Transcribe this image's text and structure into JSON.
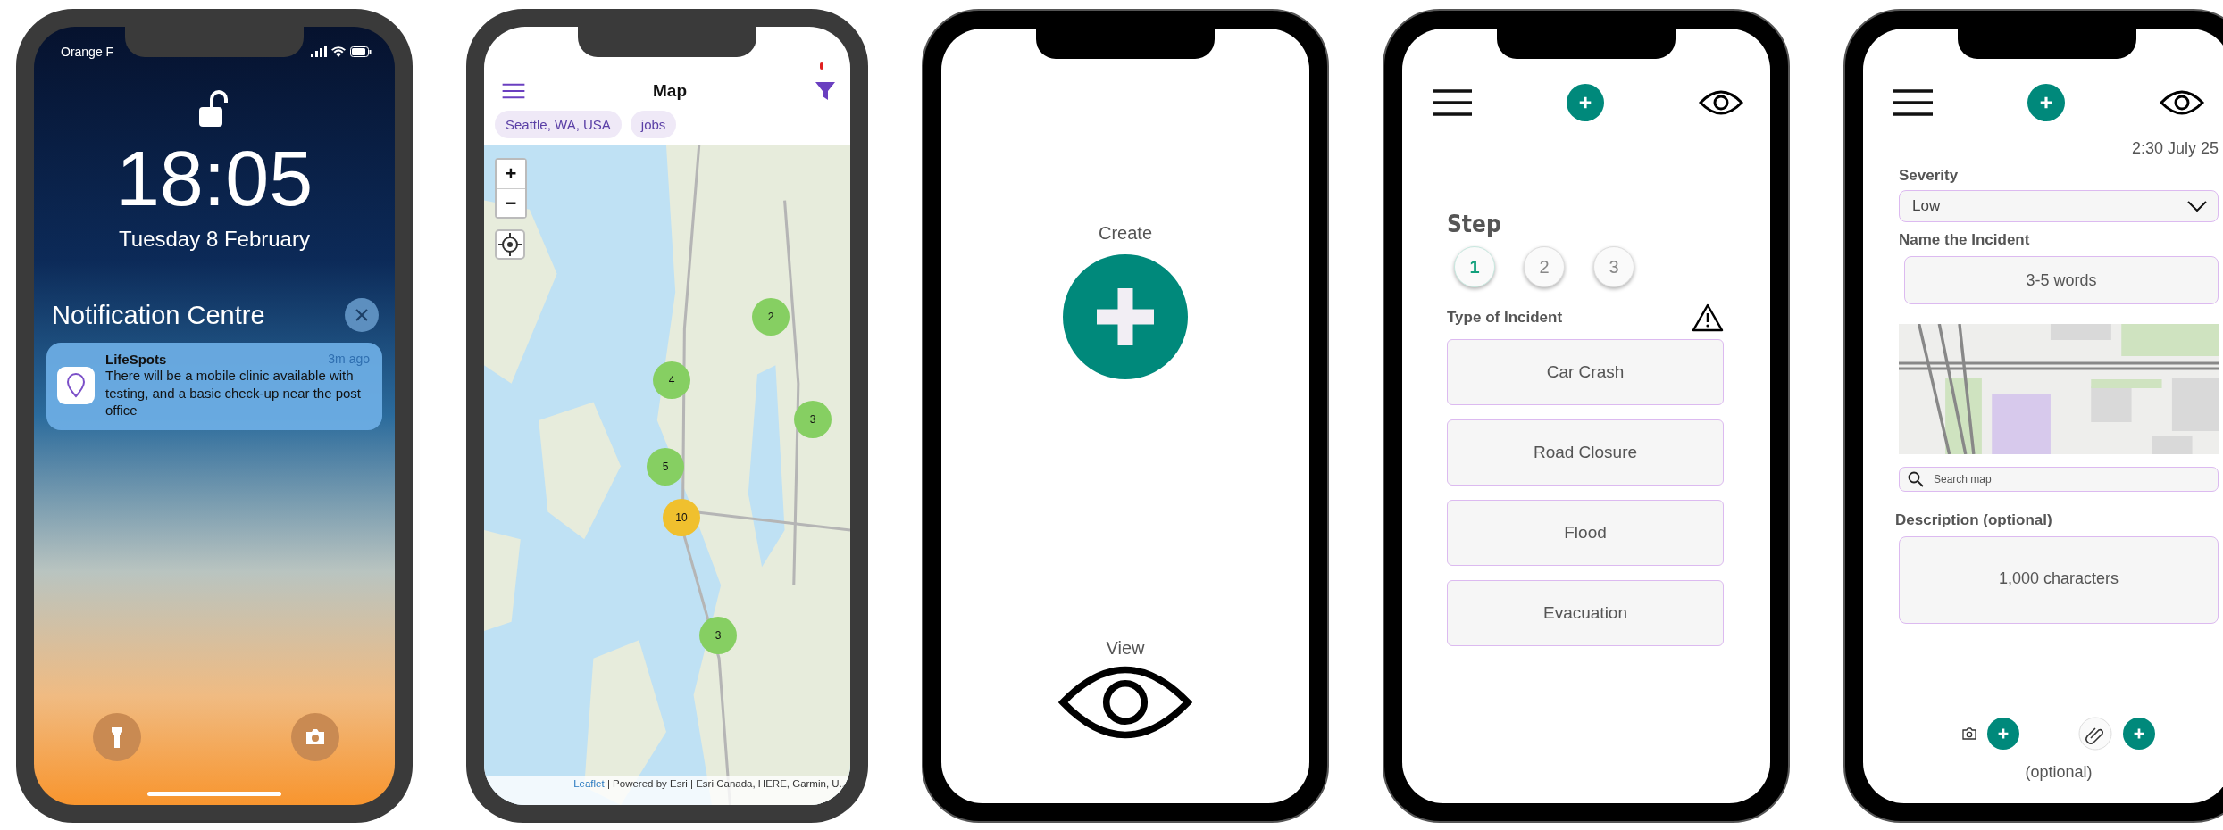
{
  "lock_screen": {
    "carrier": "Orange F",
    "time": "18:05",
    "date": "Tuesday 8 February",
    "notification_centre": "Notification Centre",
    "notification": {
      "app": "LifeSpots",
      "age": "3m ago",
      "message": "There will be a mobile clinic available with testing, and a basic check-up near the post office"
    }
  },
  "map_screen": {
    "title": "Map",
    "filters": [
      {
        "label": "Seattle, WA, USA"
      },
      {
        "label": "jobs"
      }
    ],
    "zoom_in": "+",
    "zoom_out": "−",
    "clusters": [
      {
        "count": "2",
        "color": "#86cf62"
      },
      {
        "count": "4",
        "color": "#86cf62"
      },
      {
        "count": "3",
        "color": "#86cf62"
      },
      {
        "count": "5",
        "color": "#86cf62"
      },
      {
        "count": "10",
        "color": "#f0c02e"
      },
      {
        "count": "3",
        "color": "#86cf62"
      }
    ],
    "attribution": {
      "link": "Leaflet",
      "text": "| Powered by Esri | Esri Canada, HERE, Garmin, U.."
    }
  },
  "home_screen": {
    "actions": [
      {
        "kind": "create",
        "label": "Create"
      },
      {
        "kind": "view",
        "label": "View"
      }
    ]
  },
  "incident_type_screen": {
    "step_label": "Step",
    "steps": [
      {
        "label": "1",
        "selected": true
      },
      {
        "label": "2",
        "selected": false
      },
      {
        "label": "3",
        "selected": false
      }
    ],
    "section_label": "Type of Incident",
    "options": [
      {
        "label": "Car Crash"
      },
      {
        "label": "Road Closure"
      },
      {
        "label": "Flood"
      },
      {
        "label": "Evacuation"
      }
    ]
  },
  "details_screen": {
    "timestamp": "2:30 July 25",
    "severity": {
      "label": "Severity",
      "value": "Low"
    },
    "name": {
      "label": "Name the Incident",
      "placeholder": "3-5 words"
    },
    "map_search": {
      "placeholder": "Search map"
    },
    "description": {
      "label": "Description (optional)",
      "placeholder": "1,000 characters"
    },
    "attachments_note": "(optional)"
  }
}
